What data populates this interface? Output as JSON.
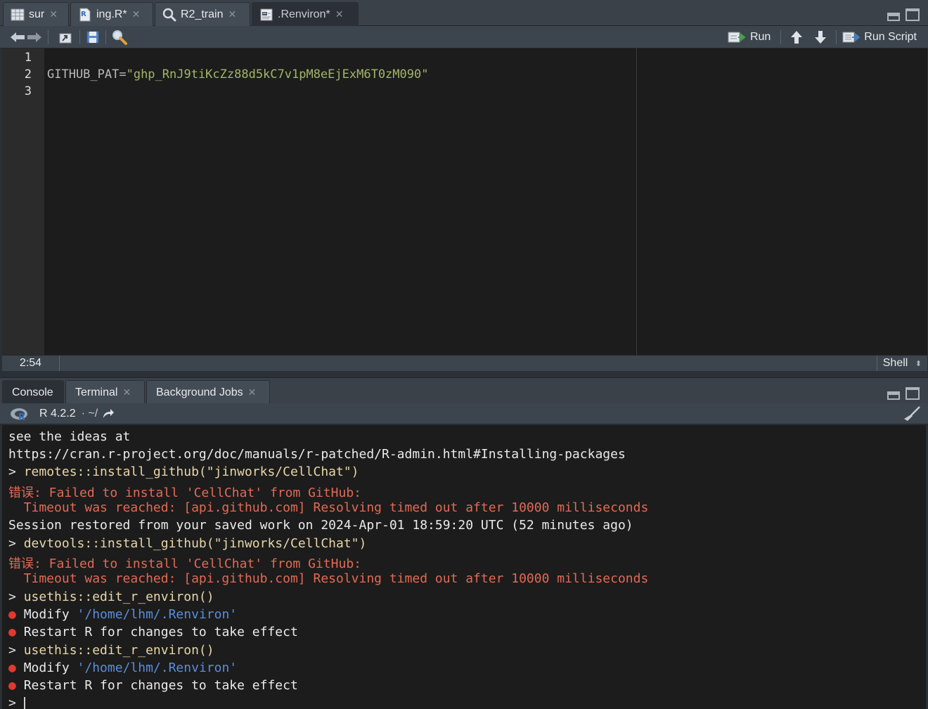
{
  "editor_tabs": [
    {
      "label": "sur",
      "icon": "table-icon",
      "active": false
    },
    {
      "label": "ing.R*",
      "icon": "r-file-icon",
      "active": false
    },
    {
      "label": "R2_train",
      "icon": "search-icon",
      "active": false
    },
    {
      "label": ".Renviron*",
      "icon": "text-file-icon",
      "active": true
    }
  ],
  "toolbar": {
    "run_label": "Run",
    "run_script_label": "Run Script"
  },
  "editor": {
    "line_numbers": [
      "1",
      "2",
      "3"
    ],
    "line2_key": "GITHUB_PAT=",
    "line2_value": "\"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\""
  },
  "status": {
    "cursor_position": "2:54",
    "file_type": "Shell"
  },
  "console_tabs": [
    {
      "label": "Console",
      "active": true,
      "closable": false
    },
    {
      "label": "Terminal",
      "active": false,
      "closable": true
    },
    {
      "label": "Background Jobs",
      "active": false,
      "closable": true
    }
  ],
  "console_header": {
    "r_version": "R 4.2.2",
    "working_dir": "· ~/"
  },
  "console_lines": [
    {
      "prefix": "",
      "text": "see the ideas at",
      "style": "plain"
    },
    {
      "prefix": "",
      "text": "https://cran.r-project.org/doc/manuals/r-patched/R-admin.html#Installing-packages",
      "style": "plain"
    },
    {
      "prefix": "> ",
      "text": "remotes::install_github(\"jinworks/CellChat\")",
      "style": "cmd"
    },
    {
      "prefix": "",
      "text": "错误: Failed to install 'CellChat' from GitHub:",
      "style": "err"
    },
    {
      "prefix": "",
      "text": "  Timeout was reached: [api.github.com] Resolving timed out after 10000 milliseconds",
      "style": "err"
    },
    {
      "prefix": "",
      "text": "Session restored from your saved work on 2024-Apr-01 18:59:20 UTC (52 minutes ago)",
      "style": "plain"
    },
    {
      "prefix": "> ",
      "text": "devtools::install_github(\"jinworks/CellChat\")",
      "style": "cmd"
    },
    {
      "prefix": "",
      "text": "错误: Failed to install 'CellChat' from GitHub:",
      "style": "err"
    },
    {
      "prefix": "",
      "text": "  Timeout was reached: [api.github.com] Resolving timed out after 10000 milliseconds",
      "style": "err"
    },
    {
      "prefix": "> ",
      "text": "usethis::edit_r_environ()",
      "style": "cmd"
    },
    {
      "prefix": "● ",
      "text": "Modify ",
      "path": "'/home/lhm/.Renviron'",
      "style": "bullet"
    },
    {
      "prefix": "● ",
      "text": "Restart R for changes to take effect",
      "style": "bullet"
    },
    {
      "prefix": "> ",
      "text": "usethis::edit_r_environ()",
      "style": "cmd"
    },
    {
      "prefix": "● ",
      "text": "Modify ",
      "path": "'/home/lhm/.Renviron'",
      "style": "bullet"
    },
    {
      "prefix": "● ",
      "text": "Restart R for changes to take effect",
      "style": "bullet"
    },
    {
      "prefix": "> ",
      "text": "",
      "style": "input"
    }
  ],
  "colors": {
    "editor_bg": "#1c1c1c",
    "string": "#a4b56a",
    "error": "#e26a55",
    "path": "#5b8ddb",
    "bullet": "#e0392f"
  }
}
